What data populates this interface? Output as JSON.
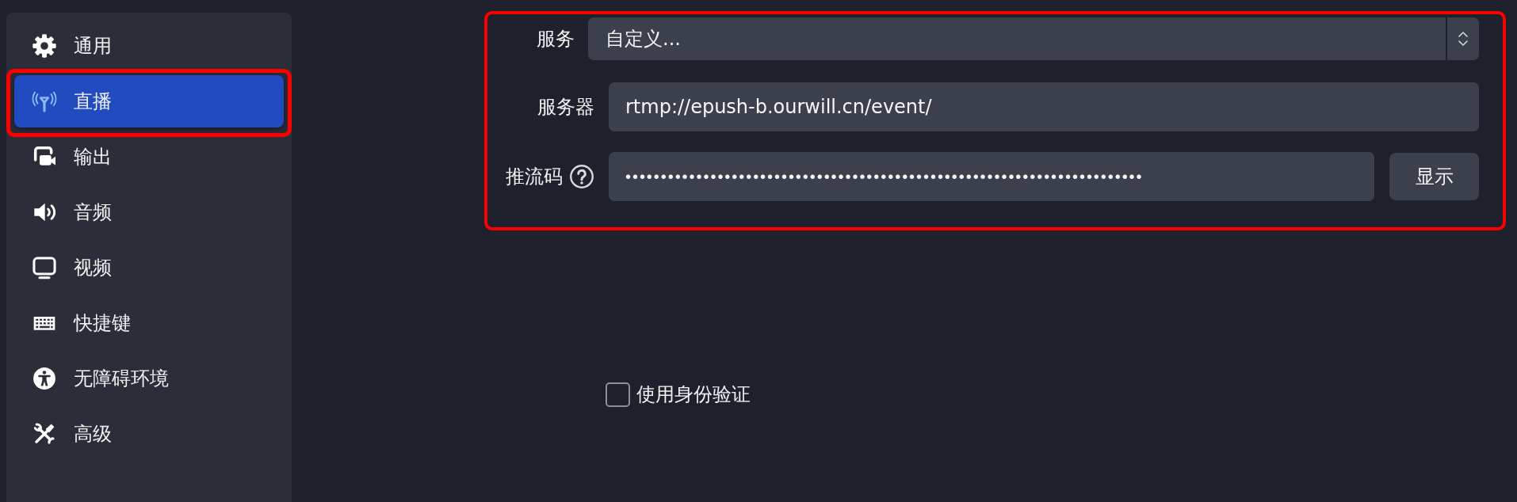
{
  "sidebar": {
    "items": [
      {
        "label": "通用",
        "selected": false,
        "highlighted": false
      },
      {
        "label": "直播",
        "selected": true,
        "highlighted": true
      },
      {
        "label": "输出",
        "selected": false,
        "highlighted": false
      },
      {
        "label": "音频",
        "selected": false,
        "highlighted": false
      },
      {
        "label": "视频",
        "selected": false,
        "highlighted": false
      },
      {
        "label": "快捷键",
        "selected": false,
        "highlighted": false
      },
      {
        "label": "无障碍环境",
        "selected": false,
        "highlighted": false
      },
      {
        "label": "高级",
        "selected": false,
        "highlighted": false
      }
    ]
  },
  "stream_settings": {
    "highlighted": true,
    "service": {
      "label": "服务",
      "value": "自定义..."
    },
    "server": {
      "label": "服务器",
      "value": "rtmp://epush-b.ourwill.cn/event/"
    },
    "stream_key": {
      "label": "推流码",
      "value": "•••••••••••••••••••••••••••••••••••••••••••••••••••••••••••••••••••••••••",
      "button": "显示"
    }
  },
  "authentication": {
    "label": "使用身份验证",
    "checked": false
  }
}
